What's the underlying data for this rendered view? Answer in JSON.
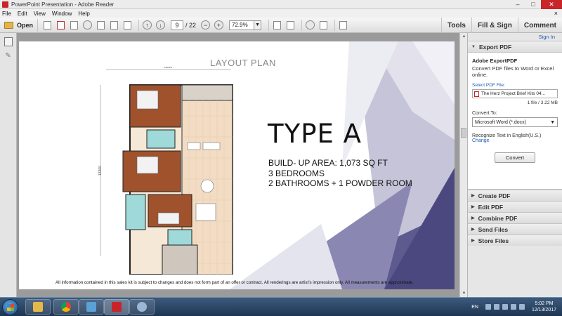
{
  "window": {
    "title": "PowerPoint Presentation - Adobe Reader",
    "minimize": "–",
    "maximize": "□",
    "close": "✕"
  },
  "menu": {
    "items": [
      "File",
      "Edit",
      "View",
      "Window",
      "Help"
    ],
    "close_doc": "×"
  },
  "toolbar": {
    "open_label": "Open",
    "current_page": "9",
    "total_pages": "/ 22",
    "zoom": "72.9%",
    "tools": "Tools",
    "fill_sign": "Fill & Sign",
    "comment": "Comment"
  },
  "document": {
    "layout_title": "LAYOUT PLAN",
    "type_heading": "TYPE A",
    "specs": [
      "BUILD- UP AREA: 1,073 SQ FT",
      "3 BEDROOMS",
      "2 BATHROOMS + 1 POWDER ROOM"
    ],
    "dim_top": "8800",
    "dim_side": "13300",
    "disclaimer": "All information contained in  this sales kit is subject to changes and does not form part of an offer or contract. All renderings are artist's impression only. All measurements are approximate."
  },
  "right_pane": {
    "sign_in": "Sign In",
    "export_header": "Export PDF",
    "export_title": "Adobe ExportPDF",
    "export_desc": "Convert PDF files to Word or Excel online.",
    "select_file_label": "Select PDF File:",
    "file_name": "The Herz Project Brief Kits 04...",
    "file_count": "1 file / 3.22 MB",
    "convert_to_label": "Convert To:",
    "convert_to_value": "Microsoft Word (*.docx)",
    "recognize_text": "Recognize Text in English(U.S.)",
    "change_link": "Change",
    "convert_button": "Convert",
    "sections": [
      "Create PDF",
      "Edit PDF",
      "Combine PDF",
      "Send Files",
      "Store Files"
    ]
  },
  "taskbar": {
    "language": "EN",
    "time": "5:02 PM",
    "date": "12/13/2017"
  },
  "colors": {
    "accent_link": "#1c5db3",
    "close_button": "#c8242a",
    "taskbar": "#1e3552",
    "bedroom_floor": "#a0522d",
    "bathroom_tile": "#9fd9d9"
  }
}
